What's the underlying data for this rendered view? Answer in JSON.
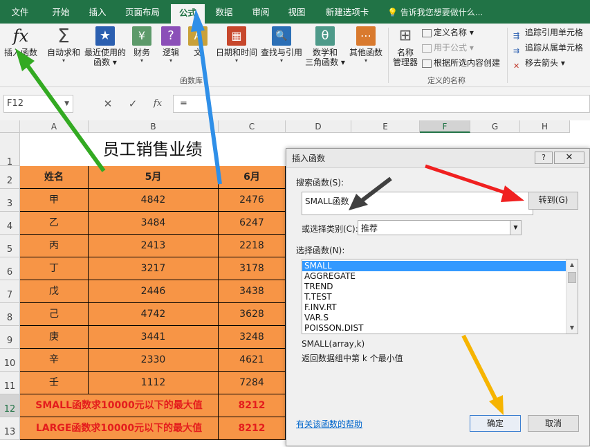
{
  "menu": {
    "tabs": [
      "文件",
      "开始",
      "插入",
      "页面布局",
      "公式",
      "数据",
      "审阅",
      "视图",
      "新建选项卡"
    ],
    "active": "公式",
    "tell": "告诉我您想要做什么..."
  },
  "ribbon": {
    "buttons": [
      {
        "icon": "fx",
        "label1": "插入函数",
        "label2": ""
      },
      {
        "icon": "Σ",
        "label1": "自动求和",
        "label2": "▾"
      },
      {
        "icon": "★",
        "label1": "最近使用的",
        "label2": "函数 ▾"
      },
      {
        "icon": "¥",
        "label1": "财务",
        "label2": "▾"
      },
      {
        "icon": "?",
        "label1": "逻辑",
        "label2": "▾"
      },
      {
        "icon": "A",
        "label1": "文",
        "label2": ""
      },
      {
        "icon": "▦",
        "label1": "日期和时间",
        "label2": "▾"
      },
      {
        "icon": "🔍",
        "label1": "查找与引用",
        "label2": "▾"
      },
      {
        "icon": "θ",
        "label1": "数学和",
        "label2": "三角函数 ▾"
      },
      {
        "icon": "⋯",
        "label1": "其他函数",
        "label2": "▾"
      },
      {
        "icon": "⊞",
        "label1": "名称",
        "label2": "管理器"
      }
    ],
    "names": [
      "定义名称 ▾",
      "用于公式 ▾",
      "根据所选内容创建"
    ],
    "audit": [
      "追踪引用单元格",
      "追踪从属单元格",
      "移去箭头 ▾"
    ],
    "groups": [
      "函数库",
      "定义的名称"
    ]
  },
  "formula": {
    "namebox": "F12",
    "value": "=",
    "cancel": "✕",
    "enter": "✓",
    "fx": "fx"
  },
  "columns": [
    "A",
    "B",
    "C",
    "D",
    "E",
    "F",
    "G",
    "H"
  ],
  "rows": [
    "1",
    "2",
    "3",
    "4",
    "5",
    "6",
    "7",
    "8",
    "9",
    "10",
    "11",
    "12",
    "13"
  ],
  "sheet": {
    "title": "员工销售业绩",
    "headers": [
      "姓名",
      "5月",
      "6月"
    ],
    "data": [
      [
        "甲",
        "4842",
        "2476"
      ],
      [
        "乙",
        "3484",
        "6247"
      ],
      [
        "丙",
        "2413",
        "2218"
      ],
      [
        "丁",
        "3217",
        "3178"
      ],
      [
        "戊",
        "2446",
        "3438"
      ],
      [
        "己",
        "4742",
        "3628"
      ],
      [
        "庚",
        "3441",
        "3248"
      ],
      [
        "辛",
        "2330",
        "4621"
      ],
      [
        "壬",
        "1112",
        "7284"
      ]
    ],
    "summary": [
      [
        "SMALL函数求10000元以下的最大值",
        "8212"
      ],
      [
        "LARGE函数求10000元以下的最大值",
        "8212"
      ]
    ]
  },
  "dialog": {
    "title": "插入函数",
    "help_btn": "?",
    "close_btn": "✕",
    "search_label": "搜索函数(S):",
    "search_value": "SMALL函数",
    "goto": "转到(G)",
    "category_label": "或选择类别(C):",
    "category_value": "推荐",
    "select_label": "选择函数(N):",
    "functions": [
      "SMALL",
      "AGGREGATE",
      "TREND",
      "T.TEST",
      "F.INV.RT",
      "VAR.S",
      "POISSON.DIST"
    ],
    "signature": "SMALL(array,k)",
    "description": "返回数据组中第 k 个最小值",
    "help_link": "有关该函数的帮助",
    "ok": "确定",
    "cancel": "取消"
  },
  "annotation_colors": {
    "green": "#33aa22",
    "blue": "#2f8fe8",
    "red": "#f02020",
    "gray": "#404040",
    "orange": "#f6b400"
  }
}
